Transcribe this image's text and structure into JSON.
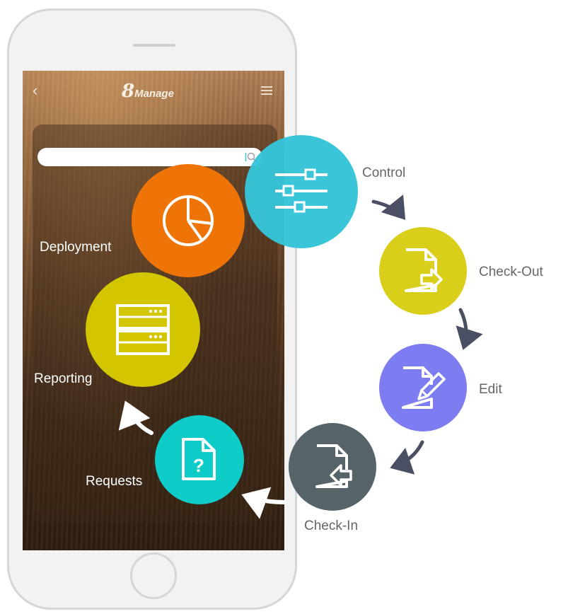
{
  "app": {
    "logo_mark": "8",
    "logo_text": "Manage",
    "back_glyph": "‹"
  },
  "nodes": {
    "control": {
      "label": "Control",
      "color": "#35C4D8",
      "icon": "sliders-icon"
    },
    "check_out": {
      "label": "Check-Out",
      "color": "#D9CE1A",
      "icon": "document-export-icon"
    },
    "edit": {
      "label": "Edit",
      "color": "#7D7CF0",
      "icon": "document-edit-icon"
    },
    "check_in": {
      "label": "Check-In",
      "color": "#566368",
      "icon": "document-import-icon"
    },
    "requests": {
      "label": "Requests",
      "color": "#0ECCC8",
      "icon": "document-question-icon"
    },
    "reporting": {
      "label": "Reporting",
      "color": "#D3C500",
      "icon": "server-icon"
    },
    "deployment": {
      "label": "Deployment",
      "color": "#EE7407",
      "icon": "pie-chart-icon"
    }
  },
  "requests_glyph": "?",
  "colors": {
    "arrow_dark": "#4A4F63",
    "arrow_light": "#FFFFFF",
    "search_icon": "#38C3D4"
  }
}
